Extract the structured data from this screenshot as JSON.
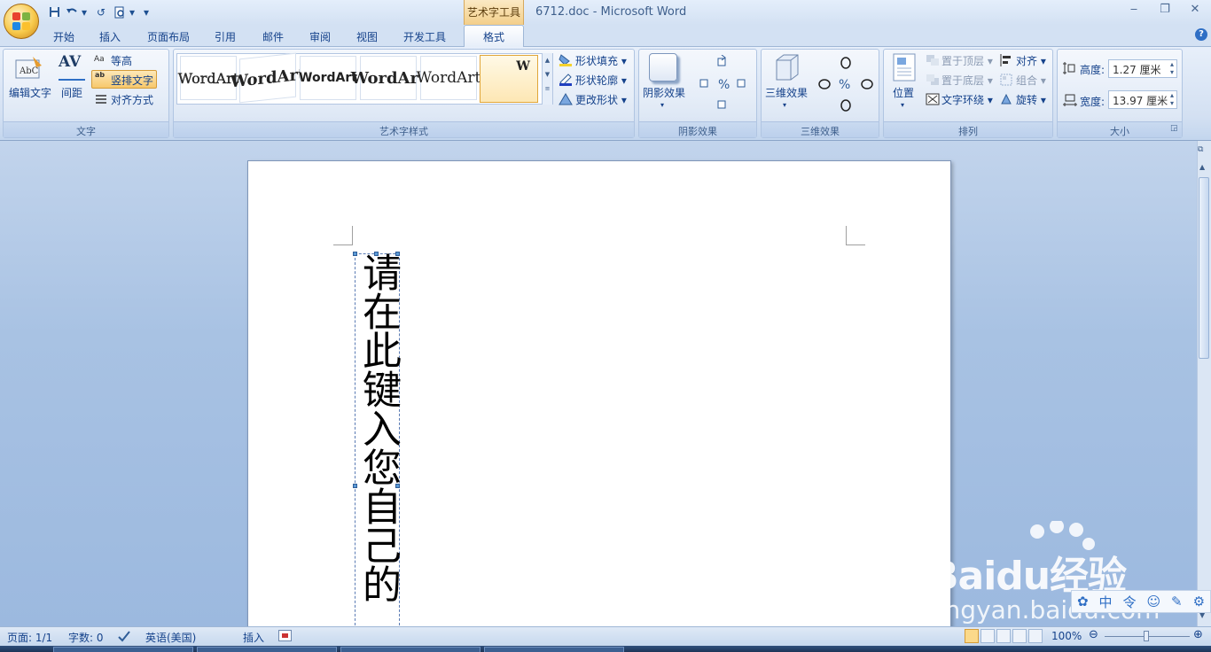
{
  "window": {
    "title": "6712.doc - Microsoft Word",
    "context_tool": "艺术字工具",
    "min": "‒",
    "max": "❐",
    "close": "✕"
  },
  "qat": {
    "redo": "↺",
    "more": "▾"
  },
  "tabs": [
    "开始",
    "插入",
    "页面布局",
    "引用",
    "邮件",
    "审阅",
    "视图",
    "开发工具"
  ],
  "active_tab": "格式",
  "help_label": "?",
  "ribbon": {
    "text_group": {
      "label": "文字",
      "edit_text": "编辑文字",
      "spacing_icon_text": "AV",
      "spacing": "间距",
      "even_height": "等高",
      "vertical_text": "竖排文字",
      "align": "对齐方式",
      "aa_icon_text": "Aa",
      "ab_icon_text": "ab"
    },
    "wordart_group": {
      "label": "艺术字样式",
      "styles": [
        "WordArt",
        "WordArt",
        "WordArt",
        "WordArt",
        "WordArt",
        "W"
      ],
      "shape_fill": "形状填充",
      "shape_outline": "形状轮廓",
      "change_shape": "更改形状"
    },
    "shadow_group": {
      "label": "阴影效果",
      "shadow": "阴影效果"
    },
    "threed_group": {
      "label": "三维效果",
      "threed": "三维效果"
    },
    "arrange_group": {
      "label": "排列",
      "position": "位置",
      "bring_front": "置于顶层",
      "send_back": "置于底层",
      "wrap_text": "文字环绕",
      "align": "对齐",
      "group": "组合",
      "rotate": "旋转"
    },
    "size_group": {
      "label": "大小",
      "height_label": "高度:",
      "height_value": "1.27 厘米",
      "width_label": "宽度:",
      "width_value": "13.97 厘米"
    }
  },
  "document": {
    "wordart_text": "请在此键入您自己的"
  },
  "statusbar": {
    "page": "页面: 1/1",
    "words": "字数: 0",
    "language": "英语(美国)",
    "mode": "插入",
    "zoom": "100%",
    "minus": "⊖",
    "plus": "⊕"
  },
  "watermark": {
    "brand": "Baidu经验",
    "url": "jingyan.baidu.com"
  },
  "ime": {
    "items": [
      "中",
      "令",
      "☺",
      "✎",
      "⚙"
    ]
  },
  "colors": {
    "accent": "#15428b",
    "ribbon_bg": "#d3e1f3",
    "context_tab": "#f3cf8a"
  }
}
